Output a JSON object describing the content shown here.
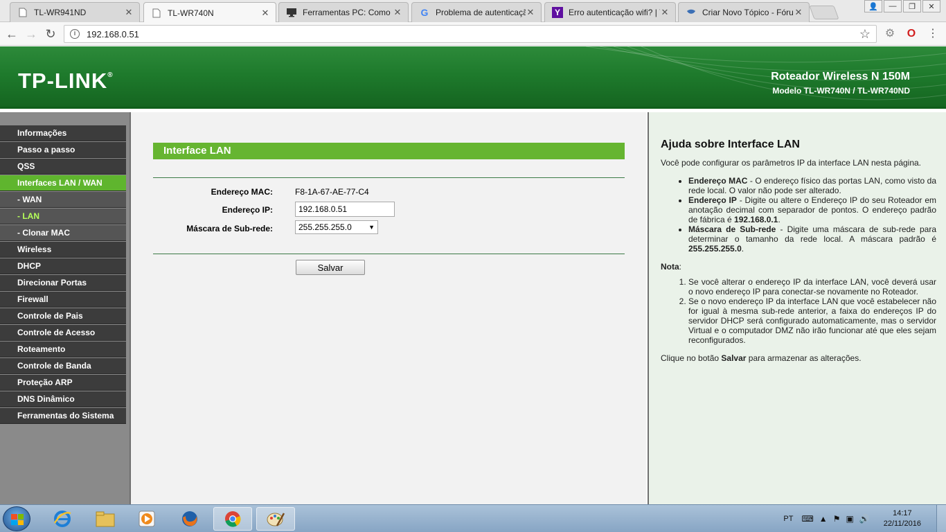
{
  "browser": {
    "tabs": [
      {
        "title": "TL-WR941ND",
        "favicon": "page-icon",
        "active": false
      },
      {
        "title": "TL-WR740N",
        "favicon": "page-icon",
        "active": true
      },
      {
        "title": "Ferramentas PC: Como li",
        "favicon": "monitor-icon",
        "active": false
      },
      {
        "title": "Problema de autenticaçã",
        "favicon": "google-icon",
        "active": false
      },
      {
        "title": "Erro autenticação wifi? | Y",
        "favicon": "yahoo-icon",
        "active": false
      },
      {
        "title": "Criar Novo Tópico - Fóru",
        "favicon": "forum-icon",
        "active": false
      }
    ],
    "url": "192.168.0.51"
  },
  "header": {
    "logo": "TP-LINK",
    "product_line": "Roteador Wireless N 150M",
    "model_line": "Modelo TL-WR740N / TL-WR740ND"
  },
  "sidebar": {
    "items": [
      {
        "label": "Informações",
        "type": "main",
        "state": ""
      },
      {
        "label": "Passo a passo",
        "type": "main",
        "state": ""
      },
      {
        "label": "QSS",
        "type": "main",
        "state": ""
      },
      {
        "label": "Interfaces LAN / WAN",
        "type": "main",
        "state": "active"
      },
      {
        "label": "- WAN",
        "type": "sub",
        "state": ""
      },
      {
        "label": "- LAN",
        "type": "sub",
        "state": "current"
      },
      {
        "label": "- Clonar MAC",
        "type": "sub",
        "state": ""
      },
      {
        "label": "Wireless",
        "type": "main",
        "state": ""
      },
      {
        "label": "DHCP",
        "type": "main",
        "state": ""
      },
      {
        "label": "Direcionar Portas",
        "type": "main",
        "state": ""
      },
      {
        "label": "Firewall",
        "type": "main",
        "state": ""
      },
      {
        "label": "Controle de Pais",
        "type": "main",
        "state": ""
      },
      {
        "label": "Controle de Acesso",
        "type": "main",
        "state": ""
      },
      {
        "label": "Roteamento",
        "type": "main",
        "state": ""
      },
      {
        "label": "Controle de Banda",
        "type": "main",
        "state": ""
      },
      {
        "label": "Proteção ARP",
        "type": "main",
        "state": ""
      },
      {
        "label": "DNS Dinâmico",
        "type": "main",
        "state": ""
      },
      {
        "label": "Ferramentas do Sistema",
        "type": "main",
        "state": ""
      }
    ]
  },
  "main": {
    "title": "Interface LAN",
    "fields": {
      "mac_label": "Endereço MAC:",
      "mac_value": "F8-1A-67-AE-77-C4",
      "ip_label": "Endereço IP:",
      "ip_value": "192.168.0.51",
      "mask_label": "Máscara de Sub-rede:",
      "mask_value": "255.255.255.0"
    },
    "save_label": "Salvar"
  },
  "help": {
    "title": "Ajuda sobre Interface LAN",
    "intro": "Você pode configurar os parâmetros IP da interface LAN nesta página.",
    "bullets": [
      {
        "term": "Endereço MAC",
        "text": " - O endereço físico das portas LAN, como visto da rede local. O valor não pode ser alterado.",
        "strong": "",
        "tail": ""
      },
      {
        "term": "Endereço IP",
        "text": " - Digite ou altere o Endereço IP do seu Roteador em anotação decimal com separador de pontos. O endereço padrão de fábrica é ",
        "strong": "192.168.0.1",
        "tail": "."
      },
      {
        "term": "Máscara de Sub-rede",
        "text": " - Digite uma máscara de sub-rede para determinar o tamanho da rede local. A máscara padrão é ",
        "strong": "255.255.255.0",
        "tail": "."
      }
    ],
    "note_label": "Nota",
    "notes": [
      "Se você alterar o endereço IP da interface LAN, você deverá usar o novo endereço IP para conectar-se novamente no Roteador.",
      "Se o novo endereço IP da interface LAN que você estabelecer não for igual à mesma sub-rede anterior, a faixa do endereços IP do servidor DHCP será configurado automaticamente, mas o servidor Virtual e o computador DMZ não irão funcionar até que eles sejam reconfigurados."
    ],
    "footer_pre": "Clique no botão ",
    "footer_strong": "Salvar",
    "footer_post": " para armazenar as alterações."
  },
  "taskbar": {
    "apps": [
      "ie-icon",
      "folder-icon",
      "media-player-icon",
      "firefox-icon",
      "chrome-icon",
      "paint-icon"
    ],
    "language": "PT",
    "time": "14:17",
    "date": "22/11/2016"
  },
  "colors": {
    "header_green": "#1e7a2c",
    "title_bar_green": "#66b531",
    "menu_active_green": "#5fb52e",
    "menu_dark": "#3c3c3c",
    "help_bg": "#eaf2e9"
  }
}
